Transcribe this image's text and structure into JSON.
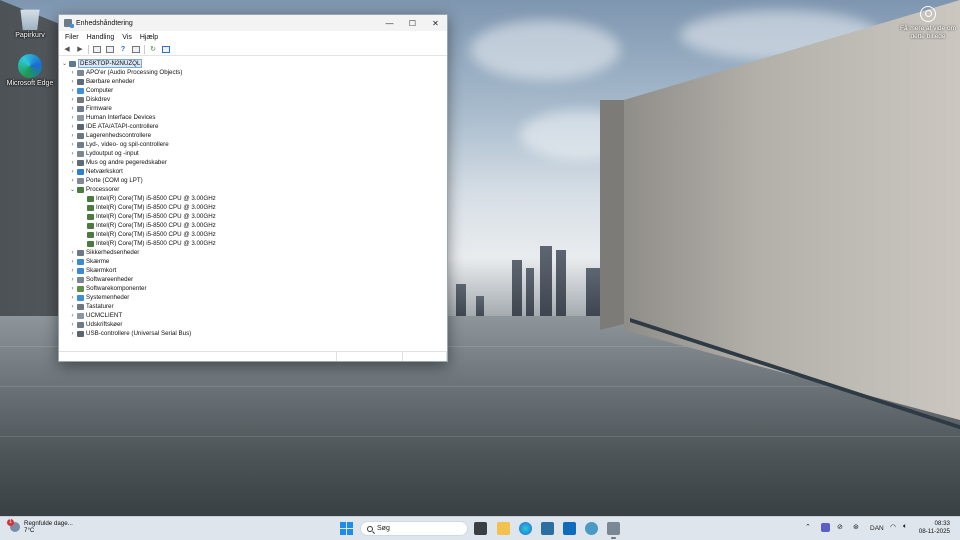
{
  "desktop": {
    "icons": [
      {
        "label": "Papirkurv"
      },
      {
        "label": "Microsoft Edge"
      }
    ],
    "spotlight_text": "Få mere at vide om dette billede"
  },
  "window": {
    "title": "Enhedshåndtering",
    "controls": {
      "minimize": "—",
      "maximize": "☐",
      "close": "✕"
    },
    "menu": [
      "Filer",
      "Handling",
      "Vis",
      "Hjælp"
    ],
    "tree": {
      "root": "DESKTOP-N2NUZQL",
      "categories": [
        {
          "label": "APO'er (Audio Processing Objects)",
          "color": "#7a8794"
        },
        {
          "label": "Bærbare enheder",
          "color": "#5a6b7c"
        },
        {
          "label": "Computer",
          "color": "#3c8fd8"
        },
        {
          "label": "Diskdrev",
          "color": "#707880"
        },
        {
          "label": "Firmware",
          "color": "#6d7b89"
        },
        {
          "label": "Human Interface Devices",
          "color": "#8a96a2"
        },
        {
          "label": "IDE ATA/ATAPI-controllere",
          "color": "#5b6570"
        },
        {
          "label": "Lagerenhedscontrollere",
          "color": "#6a7785"
        },
        {
          "label": "Lyd-, video- og spil-controllere",
          "color": "#6f7e8c"
        },
        {
          "label": "Lydoutput og -input",
          "color": "#7a8794"
        },
        {
          "label": "Mus og andre pegeredskaber",
          "color": "#5d6a77"
        },
        {
          "label": "Netværkskort",
          "color": "#2f7fd0"
        },
        {
          "label": "Porte (COM og LPT)",
          "color": "#7d8a96"
        },
        {
          "label": "Processorer",
          "color": "#4d7a3e",
          "expanded": true,
          "children": [
            "Intel(R) Core(TM) i5-8500 CPU @ 3.00GHz",
            "Intel(R) Core(TM) i5-8500 CPU @ 3.00GHz",
            "Intel(R) Core(TM) i5-8500 CPU @ 3.00GHz",
            "Intel(R) Core(TM) i5-8500 CPU @ 3.00GHz",
            "Intel(R) Core(TM) i5-8500 CPU @ 3.00GHz",
            "Intel(R) Core(TM) i5-8500 CPU @ 3.00GHz"
          ]
        },
        {
          "label": "Sikkerhedsenheder",
          "color": "#6b7885"
        },
        {
          "label": "Skærme",
          "color": "#3b8ad6"
        },
        {
          "label": "Skærmkort",
          "color": "#3b8ad6"
        },
        {
          "label": "Softwareenheder",
          "color": "#7a8794"
        },
        {
          "label": "Softwarekomponenter",
          "color": "#5f8f4a"
        },
        {
          "label": "Systemenheder",
          "color": "#3c8fd8"
        },
        {
          "label": "Tastaturer",
          "color": "#707880"
        },
        {
          "label": "UCMCLIENT",
          "color": "#8a96a2"
        },
        {
          "label": "Udskriftskøer",
          "color": "#6d7b89"
        },
        {
          "label": "USB-controllere (Universal Serial Bus)",
          "color": "#5b6570"
        }
      ]
    }
  },
  "taskbar": {
    "weather": {
      "title": "Regnfulde dage...",
      "temp": "7°C",
      "badge": "1"
    },
    "search_placeholder": "Søg",
    "language": "DAN",
    "time": "08:33",
    "date": "08-11-2025"
  }
}
